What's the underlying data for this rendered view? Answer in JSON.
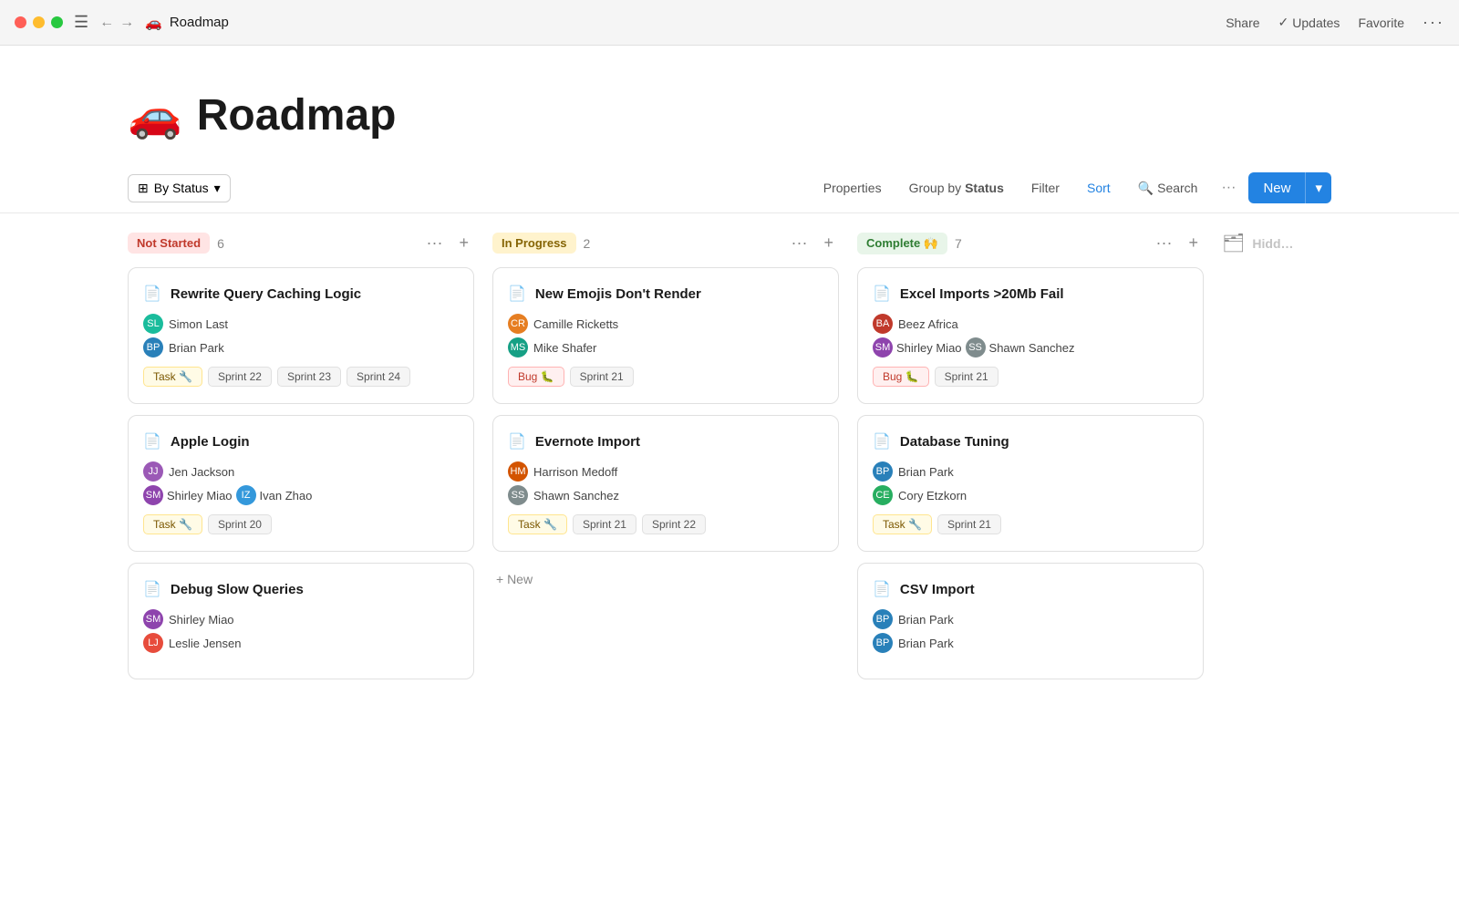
{
  "titlebar": {
    "page_name": "Roadmap",
    "page_emoji": "🚗",
    "share": "Share",
    "updates": "Updates",
    "favorite": "Favorite"
  },
  "header": {
    "emoji": "🚗",
    "title": "Roadmap"
  },
  "toolbar": {
    "by_status": "By Status",
    "properties": "Properties",
    "group_by": "Group by",
    "group_by_value": "Status",
    "filter": "Filter",
    "sort": "Sort",
    "search": "Search",
    "new": "New"
  },
  "columns": [
    {
      "id": "not-started",
      "label": "Not Started",
      "count": 6,
      "badge_class": "badge-not-started",
      "cards": [
        {
          "title": "Rewrite Query Caching Logic",
          "assignees": [
            {
              "name": "Simon Last",
              "avatar_class": "avatar-simon",
              "initials": "SL"
            },
            {
              "name": "Brian Park",
              "avatar_class": "avatar-brian",
              "initials": "BP"
            }
          ],
          "tags": [
            {
              "label": "Task 🔧",
              "class": "tag-task"
            },
            {
              "label": "Sprint 22",
              "class": "tag-sprint"
            },
            {
              "label": "Sprint 23",
              "class": "tag-sprint"
            },
            {
              "label": "Sprint 24",
              "class": "tag-sprint"
            }
          ]
        },
        {
          "title": "Apple Login",
          "assignees": [
            {
              "name": "Jen Jackson",
              "avatar_class": "avatar-jen",
              "initials": "JJ"
            },
            {
              "name": "Shirley Miao",
              "avatar_class": "avatar-shirley",
              "initials": "SM"
            },
            {
              "name": "Ivan Zhao",
              "avatar_class": "avatar-ivan",
              "initials": "IZ"
            }
          ],
          "tags": [
            {
              "label": "Task 🔧",
              "class": "tag-task"
            },
            {
              "label": "Sprint 20",
              "class": "tag-sprint"
            }
          ]
        },
        {
          "title": "Debug Slow Queries",
          "assignees": [
            {
              "name": "Shirley Miao",
              "avatar_class": "avatar-shirley",
              "initials": "SM"
            },
            {
              "name": "Leslie Jensen",
              "avatar_class": "avatar-leslie",
              "initials": "LJ"
            }
          ],
          "tags": []
        }
      ]
    },
    {
      "id": "in-progress",
      "label": "In Progress",
      "count": 2,
      "badge_class": "badge-in-progress",
      "cards": [
        {
          "title": "New Emojis Don't Render",
          "assignees": [
            {
              "name": "Camille Ricketts",
              "avatar_class": "avatar-camille",
              "initials": "CR"
            },
            {
              "name": "Mike Shafer",
              "avatar_class": "avatar-mike",
              "initials": "MS"
            }
          ],
          "tags": [
            {
              "label": "Bug 🐛",
              "class": "tag-bug"
            },
            {
              "label": "Sprint 21",
              "class": "tag-sprint"
            }
          ]
        },
        {
          "title": "Evernote Import",
          "assignees": [
            {
              "name": "Harrison Medoff",
              "avatar_class": "avatar-harrison",
              "initials": "HM"
            },
            {
              "name": "Shawn Sanchez",
              "avatar_class": "avatar-shawn",
              "initials": "SS"
            }
          ],
          "tags": [
            {
              "label": "Task 🔧",
              "class": "tag-task"
            },
            {
              "label": "Sprint 21",
              "class": "tag-sprint"
            },
            {
              "label": "Sprint 22",
              "class": "tag-sprint"
            }
          ]
        }
      ]
    },
    {
      "id": "complete",
      "label": "Complete 🙌",
      "count": 7,
      "badge_class": "badge-complete",
      "cards": [
        {
          "title": "Excel Imports >20Mb Fail",
          "assignees": [
            {
              "name": "Beez Africa",
              "avatar_class": "avatar-beez",
              "initials": "BA"
            },
            {
              "name": "Shirley Miao",
              "avatar_class": "avatar-shirley",
              "initials": "SM"
            },
            {
              "name": "Shawn Sanchez",
              "avatar_class": "avatar-shawn",
              "initials": "SS"
            }
          ],
          "tags": [
            {
              "label": "Bug 🐛",
              "class": "tag-bug"
            },
            {
              "label": "Sprint 21",
              "class": "tag-sprint"
            }
          ]
        },
        {
          "title": "Database Tuning",
          "assignees": [
            {
              "name": "Brian Park",
              "avatar_class": "avatar-brian",
              "initials": "BP"
            },
            {
              "name": "Cory Etzkorn",
              "avatar_class": "avatar-cory",
              "initials": "CE"
            }
          ],
          "tags": [
            {
              "label": "Task 🔧",
              "class": "tag-task"
            },
            {
              "label": "Sprint 21",
              "class": "tag-sprint"
            }
          ]
        },
        {
          "title": "CSV Import",
          "assignees": [
            {
              "name": "Brian Park",
              "avatar_class": "avatar-brian",
              "initials": "BP"
            },
            {
              "name": "Brian Park",
              "avatar_class": "avatar-brian",
              "initials": "BP"
            }
          ],
          "tags": []
        }
      ]
    }
  ],
  "hidden_column": {
    "label": "Hidd…"
  },
  "new_card_label": "+ New"
}
